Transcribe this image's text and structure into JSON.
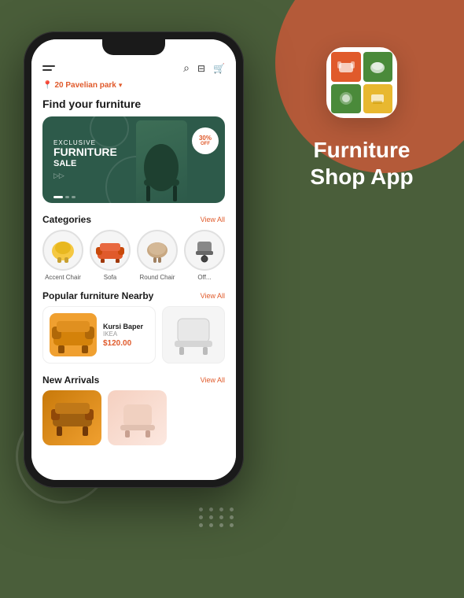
{
  "app": {
    "title": "Furniture Shop App",
    "icon_alt": "Furniture Shop App Icon"
  },
  "phone": {
    "location": "20 Pavelian park",
    "location_chevron": "▾",
    "page_title": "Find your furniture"
  },
  "banner": {
    "exclusive_label": "EXCLUSIVE",
    "furniture_label": "FURNITURE",
    "sale_label": "SALE",
    "discount_pct": "30%",
    "discount_off": "OFF"
  },
  "categories": {
    "section_title": "Categories",
    "view_all": "View All",
    "items": [
      {
        "label": "Accent Chair",
        "type": "accent"
      },
      {
        "label": "Sofa",
        "type": "sofa"
      },
      {
        "label": "Round Chair",
        "type": "round"
      },
      {
        "label": "Off...",
        "type": "office"
      }
    ]
  },
  "popular": {
    "section_title": "Popular furniture Nearby",
    "view_all": "View All",
    "items": [
      {
        "name": "Kursi Baper",
        "brand": "IKEA",
        "price": "$120.00"
      }
    ]
  },
  "new_arrivals": {
    "section_title": "New Arrivals",
    "view_all": "View All"
  },
  "top_icons": {
    "search": "⌕",
    "map": "⊞",
    "cart": "🛒"
  }
}
